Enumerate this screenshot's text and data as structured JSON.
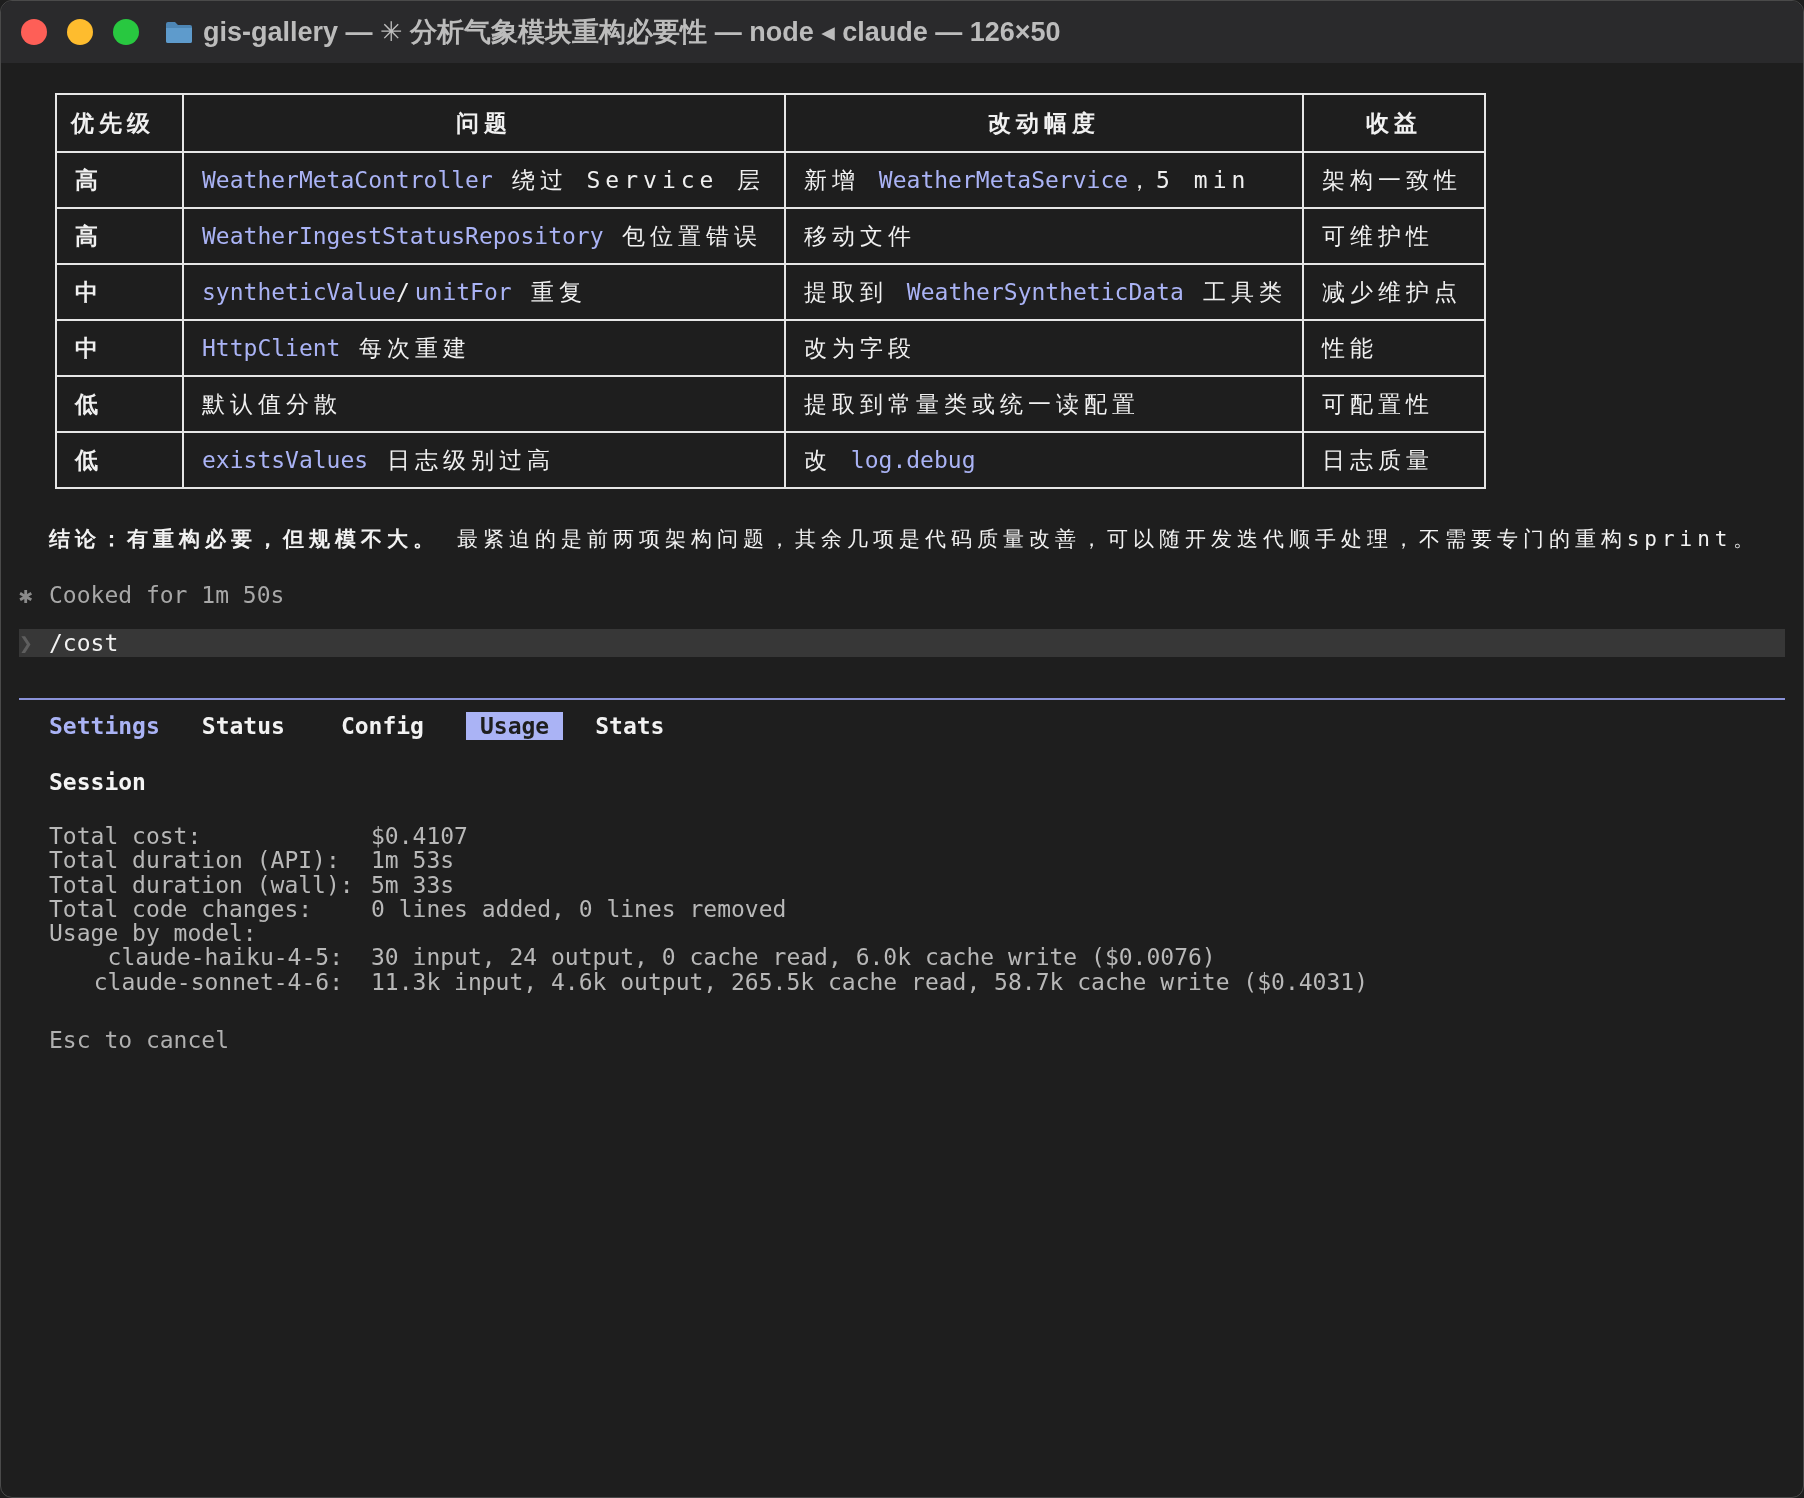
{
  "window": {
    "title": "gis-gallery — ✳ 分析气象模块重构必要性 — node ◂ claude — 126×50"
  },
  "table": {
    "columns": [
      "优先级",
      "问题",
      "改动幅度",
      "收益"
    ],
    "rows": [
      [
        [
          {
            "kind": "text",
            "text": "高"
          }
        ],
        [
          {
            "kind": "code",
            "text": "WeatherMetaController"
          },
          {
            "kind": "text",
            "text": " 绕过 Service 层"
          }
        ],
        [
          {
            "kind": "text",
            "text": "新增 "
          },
          {
            "kind": "code",
            "text": "WeatherMetaService"
          },
          {
            "kind": "text",
            "text": "，5 min"
          }
        ],
        [
          {
            "kind": "text",
            "text": "架构一致性"
          }
        ]
      ],
      [
        [
          {
            "kind": "text",
            "text": "高"
          }
        ],
        [
          {
            "kind": "code",
            "text": "WeatherIngestStatusRepository"
          },
          {
            "kind": "text",
            "text": " 包位置错误"
          }
        ],
        [
          {
            "kind": "text",
            "text": "移动文件"
          }
        ],
        [
          {
            "kind": "text",
            "text": "可维护性"
          }
        ]
      ],
      [
        [
          {
            "kind": "text",
            "text": "中"
          }
        ],
        [
          {
            "kind": "code",
            "text": "syntheticValue"
          },
          {
            "kind": "text",
            "text": "/"
          },
          {
            "kind": "code",
            "text": "unitFor"
          },
          {
            "kind": "text",
            "text": " 重复"
          }
        ],
        [
          {
            "kind": "text",
            "text": "提取到 "
          },
          {
            "kind": "code",
            "text": "WeatherSyntheticData"
          },
          {
            "kind": "text",
            "text": " 工具类"
          }
        ],
        [
          {
            "kind": "text",
            "text": "减少维护点"
          }
        ]
      ],
      [
        [
          {
            "kind": "text",
            "text": "中"
          }
        ],
        [
          {
            "kind": "code",
            "text": "HttpClient"
          },
          {
            "kind": "text",
            "text": " 每次重建"
          }
        ],
        [
          {
            "kind": "text",
            "text": "改为字段"
          }
        ],
        [
          {
            "kind": "text",
            "text": "性能"
          }
        ]
      ],
      [
        [
          {
            "kind": "text",
            "text": "低"
          }
        ],
        [
          {
            "kind": "text",
            "text": "默认值分散"
          }
        ],
        [
          {
            "kind": "text",
            "text": "提取到常量类或统一读配置"
          }
        ],
        [
          {
            "kind": "text",
            "text": "可配置性"
          }
        ]
      ],
      [
        [
          {
            "kind": "text",
            "text": "低"
          }
        ],
        [
          {
            "kind": "code",
            "text": "existsValues"
          },
          {
            "kind": "text",
            "text": " 日志级别过高"
          }
        ],
        [
          {
            "kind": "text",
            "text": "改 "
          },
          {
            "kind": "code",
            "text": "log.debug"
          }
        ],
        [
          {
            "kind": "text",
            "text": "日志质量"
          }
        ]
      ]
    ]
  },
  "conclusion": "**结论：有重构必要，但规模不大。** 最紧迫的是前两项架构问题，其余几项是代码质量改善，可以随开发迭代顺手处理，不需要专门的重构sprint。",
  "status_line": {
    "symbol": "✱",
    "text": "Cooked for 1m 50s"
  },
  "prompt": {
    "symbol": "❯",
    "text": "/cost"
  },
  "panel": {
    "heading": "Settings",
    "tabs": [
      {
        "label": "Status",
        "selected": false
      },
      {
        "label": "Config",
        "selected": false
      },
      {
        "label": "Usage",
        "selected": true
      },
      {
        "label": "Stats",
        "selected": false
      }
    ],
    "section_title": "Session",
    "stats": [
      {
        "kind": "total",
        "label": "Total cost:",
        "value": "$0.4107"
      },
      {
        "kind": "total",
        "label": "Total duration (API):",
        "value": "1m 53s"
      },
      {
        "kind": "total",
        "label": "Total duration (wall):",
        "value": "5m 33s"
      },
      {
        "kind": "total",
        "label": "Total code changes:",
        "value": "0 lines added, 0 lines removed"
      },
      {
        "kind": "group",
        "label": "Usage by model:"
      },
      {
        "kind": "model",
        "label": "claude-haiku-4-5:",
        "value": "30 input, 24 output, 0 cache read, 6.0k cache write ($0.0076)"
      },
      {
        "kind": "model",
        "label": "claude-sonnet-4-6:",
        "value": "11.3k input, 4.6k output, 265.5k cache read, 58.7k cache write ($0.4031)"
      }
    ],
    "hint": "Esc to cancel"
  }
}
